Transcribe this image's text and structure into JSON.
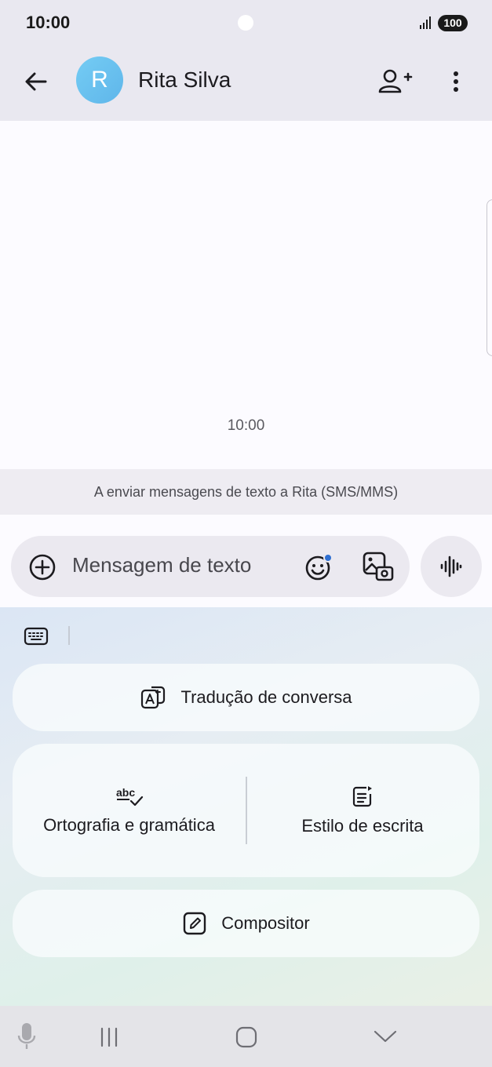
{
  "status_bar": {
    "time": "10:00",
    "battery": "100",
    "signal_icon": "signal-bars-icon"
  },
  "app_bar": {
    "back_icon": "arrow-back-icon",
    "avatar_letter": "R",
    "avatar_color": "#6fc4f0",
    "contact_name": "Rita Silva",
    "add_person_icon": "person-add-icon",
    "more_icon": "more-vert-icon"
  },
  "conversation": {
    "timestamp": "10:00",
    "sms_info": "A enviar mensagens de texto a Rita (SMS/MMS)"
  },
  "compose": {
    "placeholder": "Mensagem de texto",
    "plus_icon": "add-circle-icon",
    "emoji_icon": "emoji-icon",
    "gallery_icon": "gallery-icon",
    "voice_icon": "voice-waveform-icon"
  },
  "ai_panel": {
    "keyboard_icon": "keyboard-icon",
    "translate_label": "Tradução de conversa",
    "spelling_label": "Ortografia e gramática",
    "style_label": "Estilo de escrita",
    "composer_label": "Compositor"
  },
  "nav_bar": {
    "mic_icon": "microphone-icon",
    "recents_icon": "recents-icon",
    "home_icon": "home-icon",
    "hide_keyboard_icon": "chevron-down-icon"
  },
  "colors": {
    "header_bg": "#e9e8f0",
    "accent_dot": "#2f6fd1"
  }
}
